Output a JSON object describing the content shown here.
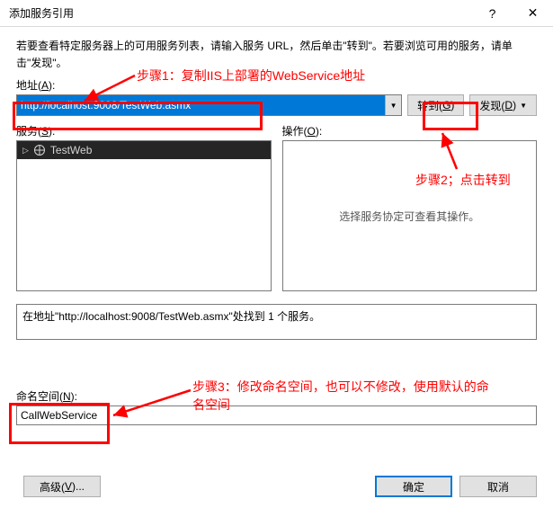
{
  "window": {
    "title": "添加服务引用",
    "help_icon": "?",
    "close_icon": "✕"
  },
  "instruction": "若要查看特定服务器上的可用服务列表，请输入服务 URL，然后单击\"转到\"。若要浏览可用的服务，请单击\"发现\"。",
  "address": {
    "label_prefix": "地址(",
    "label_key": "A",
    "label_suffix": "):",
    "value": "http://localhost:9008/TestWeb.asmx"
  },
  "buttons": {
    "go_prefix": "转到(",
    "go_key": "G",
    "go_suffix": ")",
    "discover_prefix": "发现(",
    "discover_key": "D",
    "discover_suffix": ")",
    "advanced_prefix": "高级(",
    "advanced_key": "V",
    "advanced_suffix": ")...",
    "ok": "确定",
    "cancel": "取消"
  },
  "panels": {
    "services_label_prefix": "服务(",
    "services_label_key": "S",
    "services_label_suffix": "):",
    "operations_label_prefix": "操作(",
    "operations_label_key": "O",
    "operations_label_suffix": "):",
    "tree_item": "TestWeb",
    "operations_placeholder": "选择服务协定可查看其操作。"
  },
  "status": {
    "text": "在地址\"http://localhost:9008/TestWeb.asmx\"处找到 1 个服务。"
  },
  "namespace": {
    "label_prefix": "命名空间(",
    "label_key": "N",
    "label_suffix": "):",
    "value": "CallWebService"
  },
  "annotations": {
    "step1": "步骤1：复制IIS上部署的WebService地址",
    "step2": "步骤2；点击转到",
    "step3": "步骤3：修改命名空间，也可以不修改，使用默认的命名空间"
  }
}
